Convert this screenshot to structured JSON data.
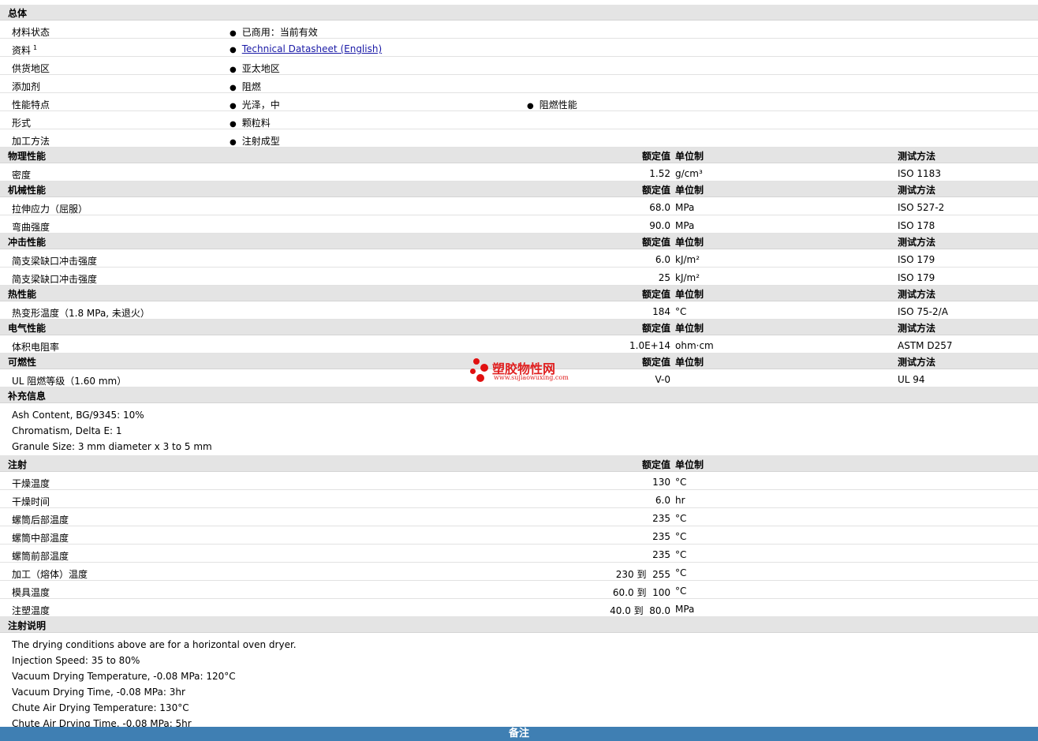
{
  "general": {
    "title": "总体",
    "rows": [
      {
        "label": "材料状态",
        "b1": "已商用：当前有效"
      },
      {
        "label": "资料",
        "sup": "1",
        "link": "Technical Datasheet (English)"
      },
      {
        "label": "供货地区",
        "b1": "亚太地区"
      },
      {
        "label": "添加剂",
        "b1": "阻燃"
      },
      {
        "label": "性能特点",
        "b1": "光泽，中",
        "b2": "阻燃性能"
      },
      {
        "label": "形式",
        "b1": "颗粒料"
      },
      {
        "label": "加工方法",
        "b1": "注射成型"
      }
    ]
  },
  "headers": {
    "value": "额定值",
    "unit": "单位制",
    "test": "测试方法"
  },
  "sections": [
    {
      "title": "物理性能",
      "rows": [
        {
          "label": "密度",
          "value": "1.52",
          "unit": "g/cm³",
          "test": "ISO 1183"
        }
      ]
    },
    {
      "title": "机械性能",
      "rows": [
        {
          "label": "拉伸应力（屈服）",
          "value": "68.0",
          "unit": "MPa",
          "test": "ISO 527-2"
        },
        {
          "label": "弯曲强度",
          "value": "90.0",
          "unit": "MPa",
          "test": "ISO 178"
        }
      ]
    },
    {
      "title": "冲击性能",
      "rows": [
        {
          "label": "简支梁缺口冲击强度",
          "value": "6.0",
          "unit": "kJ/m²",
          "test": "ISO 179"
        },
        {
          "label": "简支梁缺口冲击强度",
          "value": "25",
          "unit": "kJ/m²",
          "test": "ISO 179"
        }
      ]
    },
    {
      "title": "热性能",
      "rows": [
        {
          "label": "热变形温度（1.8 MPa, 未退火）",
          "value": "184",
          "unit": "°C",
          "test": "ISO 75-2/A"
        }
      ]
    },
    {
      "title": "电气性能",
      "rows": [
        {
          "label": "体积电阻率",
          "value": "1.0E+14",
          "unit": "ohm·cm",
          "test": "ASTM D257"
        }
      ]
    },
    {
      "title": "可燃性",
      "rows": [
        {
          "label": "UL 阻燃等级（1.60 mm）",
          "value": "V-0",
          "unit": "",
          "test": "UL 94"
        }
      ]
    }
  ],
  "supplement": {
    "title": "补充信息",
    "lines": [
      "Ash Content, BG/9345: 10%",
      "Chromatism, Delta E: 1",
      "Granule Size: 3 mm diameter x 3 to 5 mm"
    ]
  },
  "injection": {
    "title": "注射",
    "rows": [
      {
        "label": "干燥温度",
        "value": "130",
        "unit": "°C"
      },
      {
        "label": "干燥时间",
        "value": "6.0",
        "unit": "hr"
      },
      {
        "label": "螺筒后部温度",
        "value": "235",
        "unit": "°C"
      },
      {
        "label": "螺筒中部温度",
        "value": "235",
        "unit": "°C"
      },
      {
        "label": "螺筒前部温度",
        "value": "235",
        "unit": "°C"
      },
      {
        "label": "加工（熔体）温度",
        "value": "230 到  255",
        "unit": "°C"
      },
      {
        "label": "模具温度",
        "value": "60.0 到  100",
        "unit": "°C"
      },
      {
        "label": "注塑温度",
        "value": "40.0 到  80.0",
        "unit": "MPa"
      }
    ]
  },
  "injection_notes": {
    "title": "注射说明",
    "lines": [
      "The drying conditions above are for a horizontal oven dryer.",
      "Injection Speed: 35 to 80%",
      "Vacuum Drying Temperature, -0.08 MPa: 120°C",
      "Vacuum Drying Time, -0.08 MPa: 3hr",
      "Chute Air Drying Temperature: 130°C",
      "Chute Air Drying Time, -0.08 MPa: 5hr"
    ]
  },
  "footer": {
    "label": "备注"
  },
  "watermark": {
    "name": "塑胶物性网",
    "url": "www.sujiaowuxing.com"
  }
}
